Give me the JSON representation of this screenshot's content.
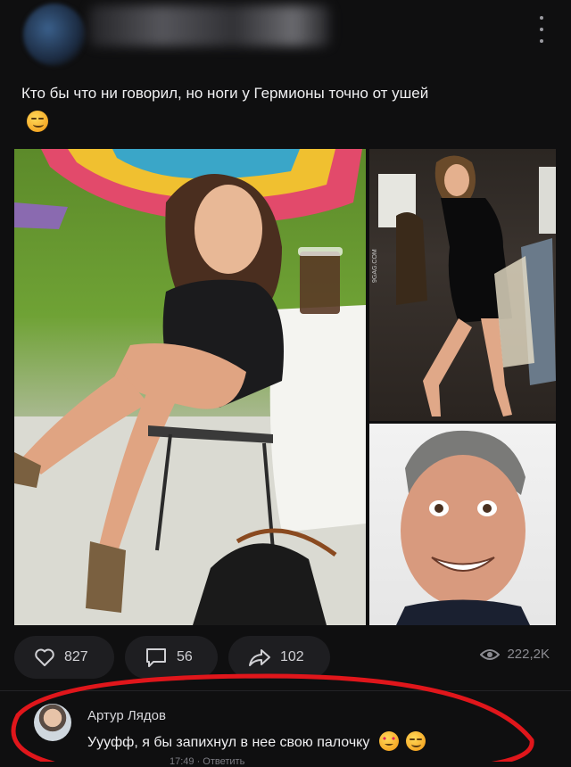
{
  "post": {
    "text": "Кто бы что ни говорил, но ноги у Гермионы точно от ушей",
    "emoji": "smirk"
  },
  "images": [
    {
      "name": "woman-sitting-photo"
    },
    {
      "name": "woman-dancing-photo",
      "watermark": "9GAG.COM"
    },
    {
      "name": "smiling-man-photo"
    }
  ],
  "actions": {
    "likes": "827",
    "comments": "56",
    "shares": "102",
    "views": "222,2K"
  },
  "comment": {
    "author": "Артур Лядов",
    "text": "Уууфф, я бы запихнул в нее свою палочку",
    "emojis": [
      "heart-eyes",
      "smirk"
    ],
    "meta": "17:49 · Ответить"
  },
  "colors": {
    "background": "#0f0f10",
    "pill": "#1e1e21",
    "annotation": "#e0161b"
  }
}
